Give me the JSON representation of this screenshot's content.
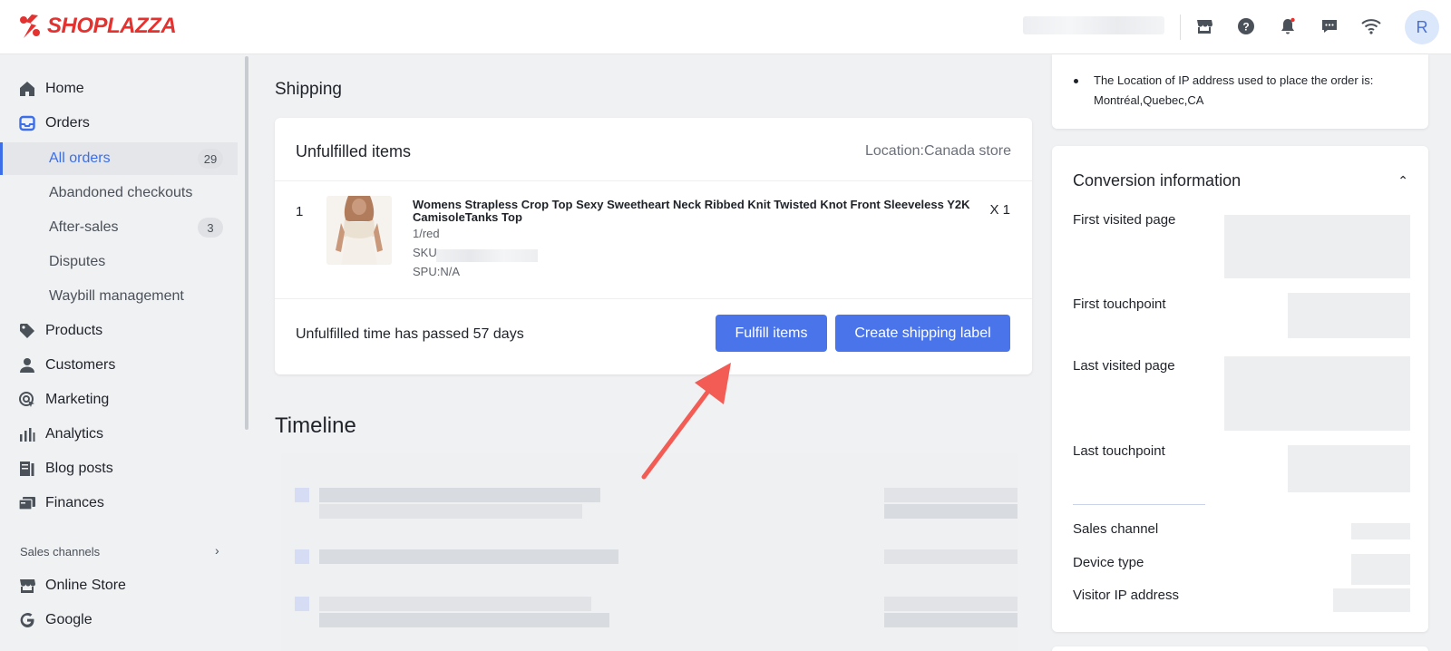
{
  "brand": {
    "name": "SHOPLAZZA",
    "color": "#e3322f"
  },
  "topbar": {
    "avatar_initial": "R",
    "icons": [
      "store-icon",
      "help-icon",
      "bell-icon",
      "message-icon",
      "wifi-icon"
    ]
  },
  "sidebar": {
    "items": [
      {
        "label": "Home",
        "icon": "home-icon"
      },
      {
        "label": "Orders",
        "icon": "inbox-icon"
      },
      {
        "label": "Products",
        "icon": "tag-icon"
      },
      {
        "label": "Customers",
        "icon": "person-icon"
      },
      {
        "label": "Marketing",
        "icon": "target-icon"
      },
      {
        "label": "Analytics",
        "icon": "bar-chart-icon"
      },
      {
        "label": "Blog posts",
        "icon": "blog-icon"
      },
      {
        "label": "Finances",
        "icon": "finance-icon"
      },
      {
        "label": "Online Store",
        "icon": "store-icon"
      },
      {
        "label": "Google",
        "icon": "google-icon"
      }
    ],
    "sub_orders": [
      {
        "label": "All orders",
        "badge": "29"
      },
      {
        "label": "Abandoned checkouts"
      },
      {
        "label": "After-sales",
        "badge": "3"
      },
      {
        "label": "Disputes"
      },
      {
        "label": "Waybill management"
      }
    ],
    "section_label": "Sales channels"
  },
  "shipping": {
    "title": "Shipping",
    "card_title": "Unfulfilled items",
    "location": "Location:Canada store",
    "item": {
      "index": "1",
      "title": "Womens Strapless Crop Top Sexy Sweetheart Neck Ribbed Knit Twisted Knot Front Sleeveless Y2K CamisoleTanks Top",
      "variant": "1/red",
      "sku_label": "SKU",
      "spu": "SPU:N/A",
      "qty": "X 1"
    },
    "unfulfilled_time": "Unfulfilled time has passed 57 days",
    "fulfill_button": "Fulfill items",
    "label_button": "Create shipping label"
  },
  "timeline": {
    "title": "Timeline"
  },
  "ip_info": {
    "text": "The Location of IP address used to place the order is: Montréal,Quebec,CA"
  },
  "conversion": {
    "title": "Conversion information",
    "labels": {
      "first_visited": "First visited page",
      "first_touch": "First touchpoint",
      "last_visited": "Last visited page",
      "last_touch": "Last touchpoint",
      "sales_channel": "Sales channel",
      "device_type": "Device type",
      "visitor_ip": "Visitor IP address"
    }
  },
  "colors": {
    "accent": "#4a74ea",
    "active_nav": "#3b6ee8",
    "arrow": "#f25c54"
  }
}
